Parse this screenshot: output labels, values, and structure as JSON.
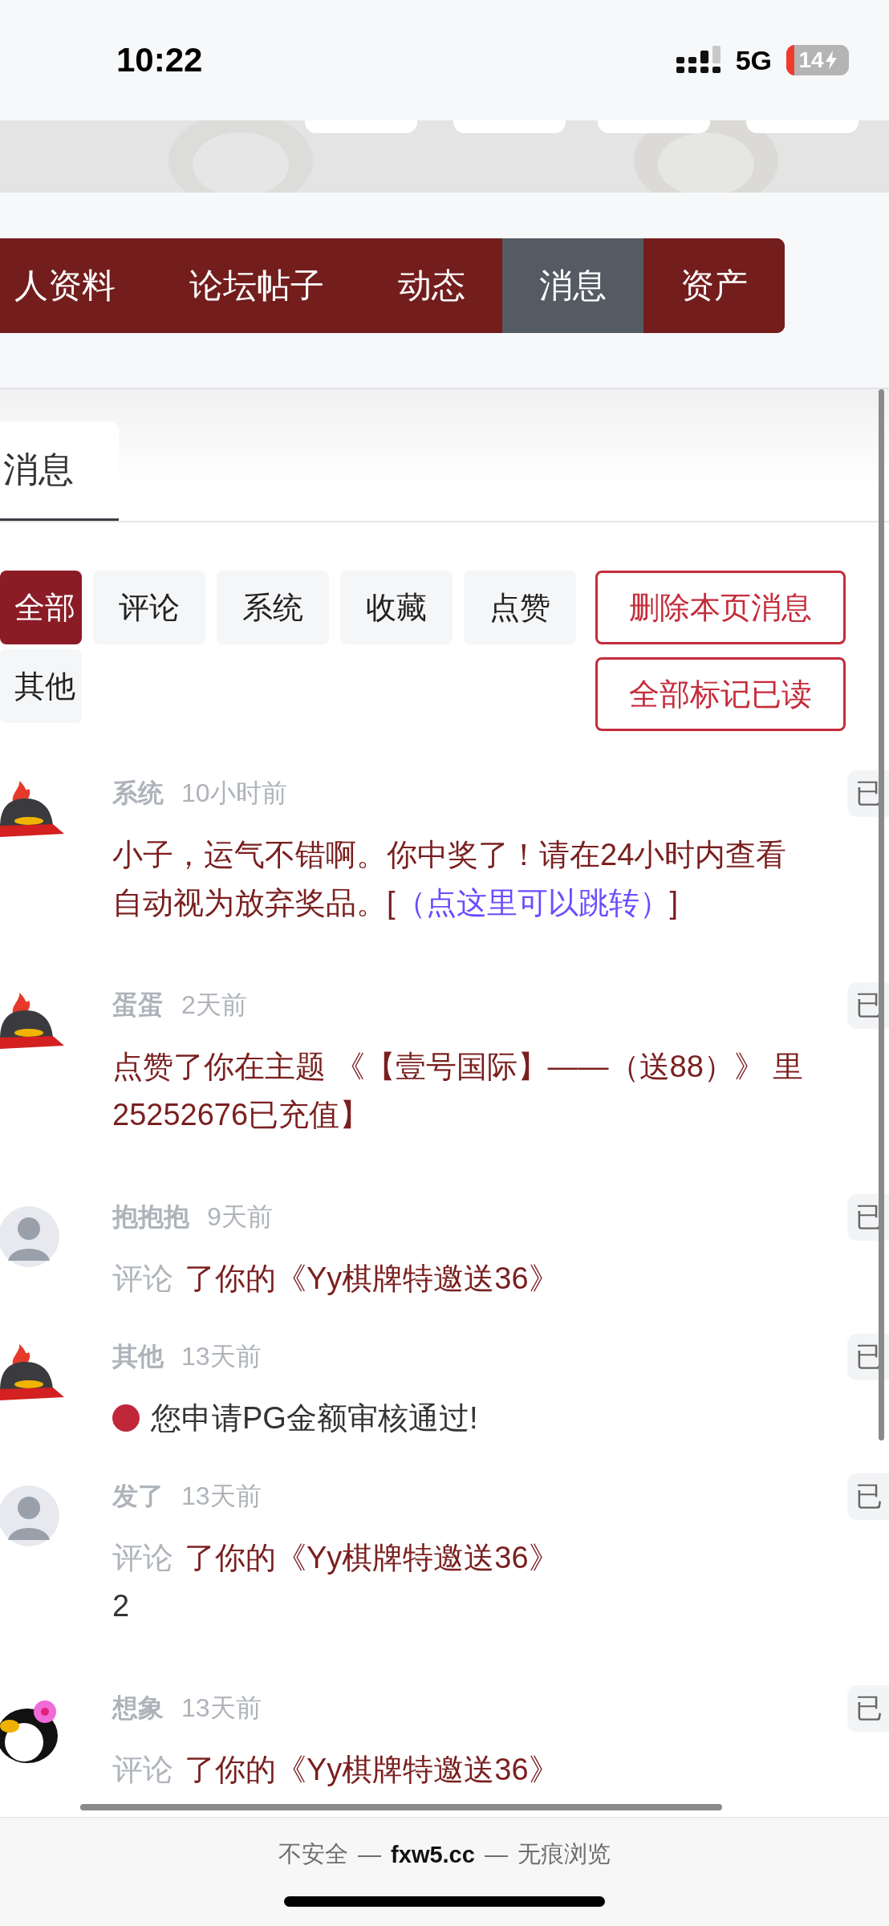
{
  "status_bar": {
    "time": "10:22",
    "network": "5G",
    "battery": "14"
  },
  "nav_tabs": [
    {
      "label": "人资料",
      "selected": false
    },
    {
      "label": "论坛帖子",
      "selected": false
    },
    {
      "label": "动态",
      "selected": false
    },
    {
      "label": "消息",
      "selected": true
    },
    {
      "label": "资产",
      "selected": false
    }
  ],
  "section_tab": {
    "label": "消息",
    "selected": true
  },
  "filters": [
    {
      "label": "全部",
      "selected": true
    },
    {
      "label": "评论",
      "selected": false
    },
    {
      "label": "系统",
      "selected": false
    },
    {
      "label": "收藏",
      "selected": false
    },
    {
      "label": "点赞",
      "selected": false
    },
    {
      "label": "其他",
      "selected": false
    }
  ],
  "actions": [
    "删除本页消息",
    "全部标记已读"
  ],
  "messages": [
    {
      "kind": "helmet",
      "name": "系统",
      "time": "10小时前",
      "status": "已",
      "lines": [
        [
          {
            "kind": "text",
            "text": "小子，运气不错啊。你中奖了！请在24小时内查看"
          }
        ],
        [
          {
            "kind": "text",
            "text": "自动视为放弃奖品。["
          },
          {
            "kind": "link",
            "text": "（点这里可以跳转）"
          },
          {
            "kind": "text",
            "text": "]"
          }
        ]
      ]
    },
    {
      "kind": "helmet",
      "name": "蛋蛋",
      "time": "2天前",
      "status": "已",
      "lines": [
        [
          {
            "kind": "text",
            "text": "点赞了你在主题 《【壹号国际】——（送88）》 里"
          }
        ],
        [
          {
            "kind": "text",
            "text": "25252676已充值】"
          }
        ]
      ]
    },
    {
      "kind": "person",
      "name": "抱抱抱",
      "time": "9天前",
      "status": "已",
      "lines": [
        [
          {
            "kind": "label",
            "text": "评论"
          },
          {
            "kind": "text",
            "text": "了你的《Yy棋牌特邀送36》"
          }
        ]
      ]
    },
    {
      "kind": "helmet",
      "name": "其他",
      "time": "13天前",
      "status": "已",
      "lines": [
        [
          {
            "kind": "dot"
          },
          {
            "kind": "plain",
            "text": "您申请PG金额审核通过!"
          }
        ]
      ]
    },
    {
      "kind": "person",
      "name": "发了",
      "time": "13天前",
      "status": "已",
      "lines": [
        [
          {
            "kind": "label",
            "text": "评论"
          },
          {
            "kind": "text",
            "text": "了你的《Yy棋牌特邀送36》"
          }
        ],
        [
          {
            "kind": "plain",
            "text": "2"
          }
        ]
      ]
    },
    {
      "kind": "penguin",
      "name": "想象",
      "time": "13天前",
      "status": "已",
      "lines": [
        [
          {
            "kind": "label",
            "text": "评论"
          },
          {
            "kind": "text",
            "text": "了你的《Yy棋牌特邀送36》"
          }
        ]
      ]
    }
  ],
  "browser_bar": {
    "security": "不安全",
    "domain": "fxw5.cc",
    "mode": "无痕浏览",
    "separator": "—"
  }
}
